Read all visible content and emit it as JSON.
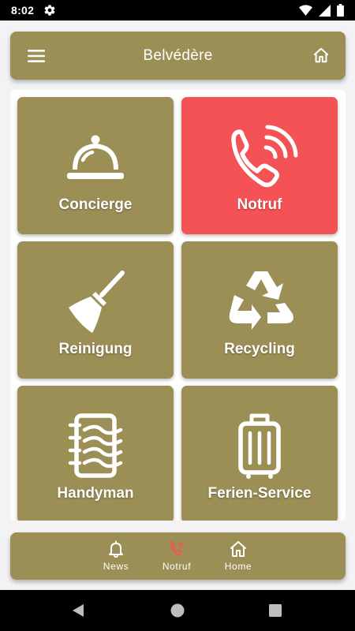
{
  "status_bar": {
    "time": "8:02",
    "icons": [
      "gear-icon",
      "wifi-icon",
      "signal-icon",
      "battery-icon"
    ]
  },
  "app_bar": {
    "title": "Belvédère",
    "menu_icon": "hamburger-menu-icon",
    "home_icon": "home-icon"
  },
  "tiles": [
    {
      "label": "Concierge",
      "icon": "cloche-icon",
      "color": "#9b8f56"
    },
    {
      "label": "Notruf",
      "icon": "phone-call-icon",
      "color": "#f55256"
    },
    {
      "label": "Reinigung",
      "icon": "broom-icon",
      "color": "#9b8f56"
    },
    {
      "label": "Recycling",
      "icon": "recycle-icon",
      "color": "#9b8f56"
    },
    {
      "label": "Handyman",
      "icon": "notebook-icon",
      "color": "#9b8f56"
    },
    {
      "label": "Ferien-Service",
      "icon": "luggage-icon",
      "color": "#9b8f56"
    }
  ],
  "bottom_nav": {
    "items": [
      {
        "label": "News",
        "icon": "bell-icon"
      },
      {
        "label": "Notruf",
        "icon": "phone-call-icon",
        "accent": "#f55256"
      },
      {
        "label": "Home",
        "icon": "home-icon"
      }
    ]
  },
  "colors": {
    "brand": "#9b8f56",
    "alert": "#f55256",
    "background": "#f3f3f5"
  },
  "android_nav": {
    "icons": [
      "back-icon",
      "home-circle-icon",
      "recents-icon"
    ]
  }
}
